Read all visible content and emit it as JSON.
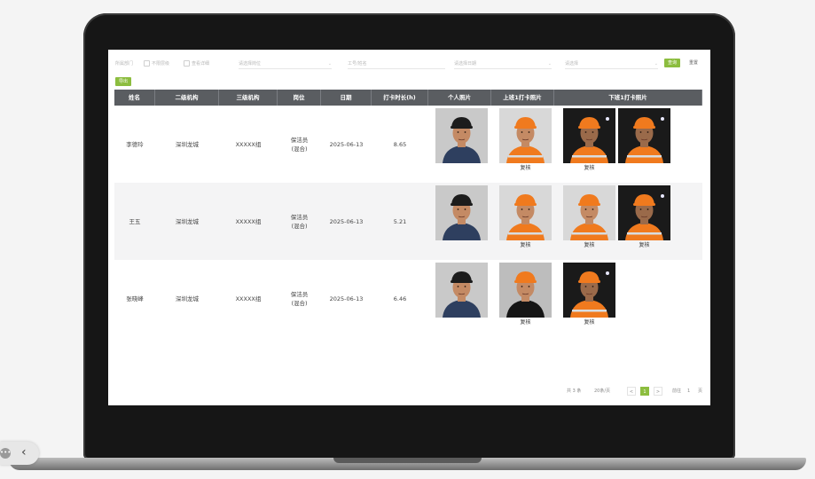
{
  "filters": {
    "f1": "所属部门",
    "f2": "不限层级",
    "f3": "查看详细",
    "f4": "请选择岗位",
    "f5": "工号/姓名",
    "f6": "请选择日期",
    "f7": "请选择",
    "search": "查询",
    "reset": "重置"
  },
  "export_label": "导出",
  "table": {
    "headers": [
      "姓名",
      "二级机构",
      "三级机构",
      "岗位",
      "日期",
      "打卡时长(h)",
      "个人照片",
      "上班1打卡照片",
      "下班1打卡照片"
    ],
    "rows": [
      {
        "name": "李德玲",
        "level2": "深圳龙城",
        "level3": "XXXXX组",
        "position": "保洁员\n(混合)",
        "date": "2025-06-13",
        "hours": "8.65",
        "photos": [
          {
            "kind": "personal",
            "label": ""
          },
          {
            "kind": "orange",
            "label": "复核"
          },
          {
            "kind": "orange-dark",
            "label": "复核"
          },
          {
            "kind": "orange-dark",
            "label": ""
          }
        ]
      },
      {
        "name": "王五",
        "level2": "深圳龙城",
        "level3": "XXXXX组",
        "position": "保洁员\n(混合)",
        "date": "2025-06-13",
        "hours": "5.21",
        "photos": [
          {
            "kind": "personal",
            "label": ""
          },
          {
            "kind": "orange",
            "label": "复核"
          },
          {
            "kind": "orange",
            "label": "复核"
          },
          {
            "kind": "orange-dark",
            "label": "复核"
          }
        ]
      },
      {
        "name": "张晓峰",
        "level2": "深圳龙城",
        "level3": "XXXXX组",
        "position": "保洁员\n(混合)",
        "date": "2025-06-13",
        "hours": "6.46",
        "photos": [
          {
            "kind": "personal",
            "label": ""
          },
          {
            "kind": "black-shirt",
            "label": "复核"
          },
          {
            "kind": "orange-dark",
            "label": "复核"
          }
        ]
      }
    ]
  },
  "pagination": {
    "total": "共 3 条",
    "page_size": "20条/页",
    "prev": "<",
    "current": "1",
    "next": ">",
    "goto_label": "前往",
    "goto_value": "1",
    "page_unit": "页"
  },
  "overlay": {
    "dots": "•••",
    "back": "‹"
  },
  "colors": {
    "accent": "#8cbd3f",
    "header_bg": "#5a5d61",
    "vest": "#f07a1e"
  }
}
